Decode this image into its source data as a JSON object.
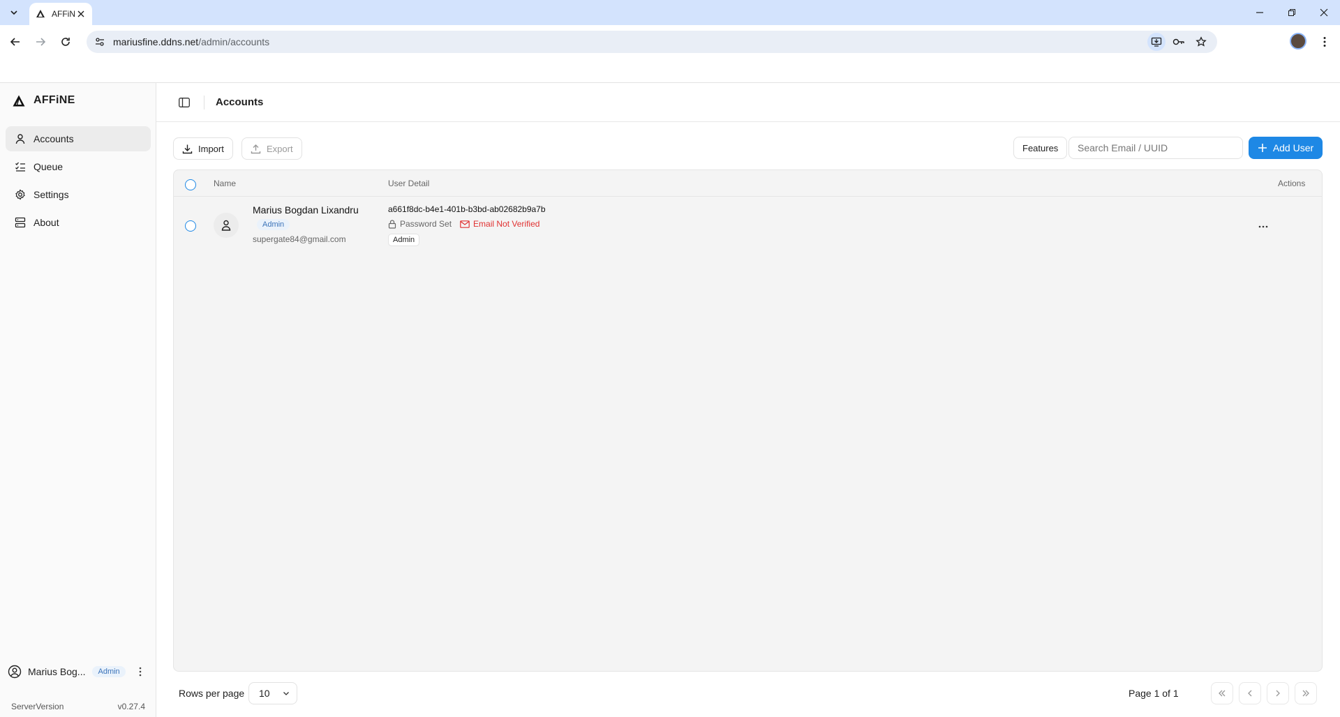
{
  "browser": {
    "tab_title": "AFFiNE",
    "url_host": "mariusfine.ddns.net",
    "url_path": "/admin/accounts"
  },
  "sidebar": {
    "brand": "AFFiNE",
    "items": [
      {
        "label": "Accounts",
        "icon": "user-icon",
        "active": true
      },
      {
        "label": "Queue",
        "icon": "list-check-icon"
      },
      {
        "label": "Settings",
        "icon": "gear-icon"
      },
      {
        "label": "About",
        "icon": "server-icon"
      }
    ],
    "current_user": {
      "name": "Marius Bog...",
      "badge": "Admin"
    },
    "server_version_label": "ServerVersion",
    "server_version": "v0.27.4"
  },
  "header": {
    "title": "Accounts"
  },
  "toolbar": {
    "import_label": "Import",
    "export_label": "Export",
    "features_label": "Features",
    "search_placeholder": "Search Email / UUID",
    "add_user_label": "Add User"
  },
  "table": {
    "columns": [
      "Name",
      "User Detail",
      "Actions"
    ],
    "rows": [
      {
        "name": "Marius Bogdan Lixandru",
        "role_badge": "Admin",
        "email": "supergate84@gmail.com",
        "uuid": "a661f8dc-b4e1-401b-b3bd-ab02682b9a7b",
        "password_status": "Password Set",
        "email_status": "Email Not Verified",
        "features": [
          "Admin"
        ]
      }
    ]
  },
  "footer": {
    "rows_per_page_label": "Rows per page",
    "rows_per_page": "10",
    "page_info": "Page 1 of 1"
  },
  "colors": {
    "accent": "#1e88e5",
    "warning": "#e03131",
    "chrome_tab_bar": "#d3e3fd"
  }
}
